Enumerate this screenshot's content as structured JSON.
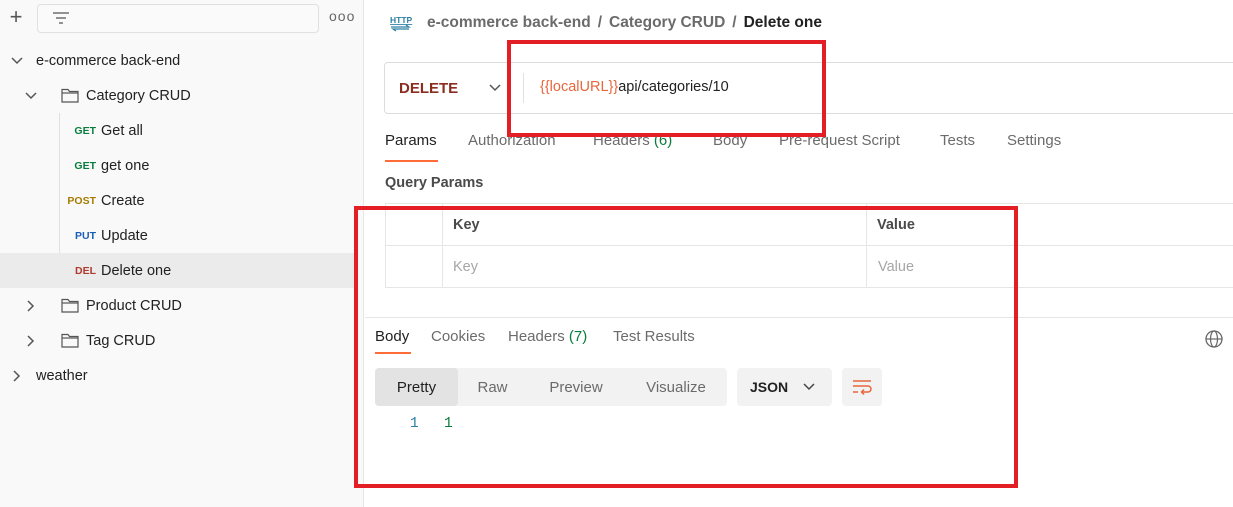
{
  "sidebar": {
    "add_icon": "plus-icon",
    "filter_icon": "filter-icon",
    "more_icon": "more-horizontal-icon",
    "more_label": "ooo",
    "tree": {
      "root": "e-commerce back-end",
      "category_folder": "Category CRUD",
      "requests": [
        {
          "method": "GET",
          "label": "Get all"
        },
        {
          "method": "GET",
          "label": "get one"
        },
        {
          "method": "POST",
          "label": "Create"
        },
        {
          "method": "PUT",
          "label": "Update"
        },
        {
          "method": "DEL",
          "label": "Delete one"
        }
      ],
      "product_folder": "Product CRUD",
      "tag_folder": "Tag CRUD",
      "weather": "weather"
    }
  },
  "header": {
    "http_icon_label": "HTTP",
    "breadcrumb": [
      "e-commerce back-end",
      "Category CRUD",
      "Delete one"
    ],
    "separator": "/"
  },
  "request": {
    "method": "DELETE",
    "url_variable": "{{localURL}}",
    "url_path": "api/categories/10",
    "tabs": [
      "Params",
      "Authorization",
      "Headers",
      "Body",
      "Pre-request Script",
      "Tests",
      "Settings"
    ],
    "headers_count": "(6)",
    "active_tab": "Params"
  },
  "query_params": {
    "title": "Query Params",
    "columns": [
      "Key",
      "Value"
    ],
    "placeholders": [
      "Key",
      "Value"
    ]
  },
  "response": {
    "tabs": [
      "Body",
      "Cookies",
      "Headers",
      "Test Results"
    ],
    "headers_count": "(7)",
    "active_tab": "Body",
    "view_modes": [
      "Pretty",
      "Raw",
      "Preview",
      "Visualize"
    ],
    "active_view": "Pretty",
    "format": "JSON",
    "lines": [
      {
        "no": "1",
        "text": "1"
      }
    ]
  },
  "colors": {
    "accent": "#ff6c37",
    "annotation": "#e31e24",
    "get": "#0a7d3e",
    "post": "#a67c00",
    "put": "#1c5db5",
    "del": "#b03a2e"
  }
}
